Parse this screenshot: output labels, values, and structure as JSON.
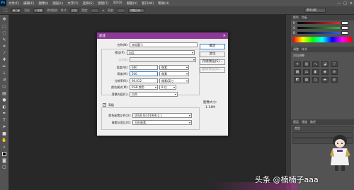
{
  "app": {
    "logo": "Ps"
  },
  "menubar": {
    "items": [
      "文件(F)",
      "编辑(E)",
      "图像(I)",
      "图层(L)",
      "文字(Y)",
      "选择(S)",
      "滤镜(T)",
      "3D(D)",
      "视图(V)",
      "窗口(W)",
      "帮助(H)"
    ],
    "window_controls": [
      "—",
      "□",
      "✕"
    ]
  },
  "options_bar": {
    "feather_label": "羽化:",
    "feather_value": "0 像素",
    "antialias_label": "消除锯齿",
    "style_label": "样式:",
    "style_value": "正常",
    "width_label": "宽度:",
    "height_label": "高度:",
    "refine_button": "调整边缘...",
    "workspace": "基本功能"
  },
  "panels": {
    "color_tabs": [
      "颜色",
      "色板"
    ],
    "sliders": [
      {
        "label": "R",
        "color": "#e03030"
      },
      {
        "label": "G",
        "color": "#30c030"
      },
      {
        "label": "B",
        "color": "#3060e0"
      }
    ],
    "adjust_tabs": [
      "调整",
      "样式"
    ],
    "adjust_title": "添加调整",
    "layer_tabs": [
      "图层",
      "通道",
      "路径"
    ],
    "layer_kind": "类型"
  },
  "dialog": {
    "title": "新建",
    "name_label": "名称(N):",
    "name_value": "未标题-1",
    "preset_label": "预设(P):",
    "preset_value": "自定",
    "size_label": "大小(I):",
    "width_label": "宽度(W):",
    "width_value": "680",
    "width_unit": "像素",
    "height_label": "高度(H):",
    "height_value": "500",
    "height_unit": "像素",
    "resolution_label": "分辨率(R):",
    "resolution_value": "96.012",
    "resolution_unit": "像素/英寸",
    "colormode_label": "颜色模式(M):",
    "colormode_value": "RGB 颜色",
    "bitdepth_value": "8 位",
    "background_label": "背景内容(C):",
    "background_value": "白色",
    "advanced_label": "高级",
    "profile_label": "颜色配置文件(O):",
    "profile_value": "sRGB IEC61966-2.1",
    "pixel_aspect_label": "像素长宽比(X):",
    "pixel_aspect_value": "方形像素",
    "ok_button": "确定",
    "reset_button": "复位",
    "save_preset_button": "存储预设(S)...",
    "delete_preset_button": "删除预设(D)...",
    "image_size_label": "图像大小:",
    "image_size_value": "1.14M"
  },
  "watermark": {
    "text": "头条 @楠楠子aaa"
  }
}
